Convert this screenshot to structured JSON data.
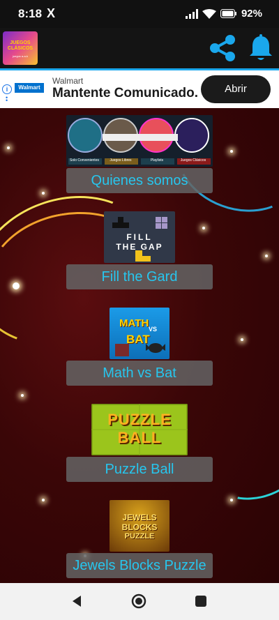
{
  "status": {
    "time": "8:18",
    "x_icon": "X",
    "battery": "92%"
  },
  "appbar": {
    "logo_title": "JUEGOS CLÁSICOS",
    "logo_subtitle": "juegos a-a-k"
  },
  "ad": {
    "brand_logo": "Walmart",
    "brand": "Walmart",
    "headline": "Mantente Comunicado.",
    "cta": "Abrir"
  },
  "menu": [
    {
      "label": "Quienes somos",
      "thumb": "about-collage",
      "captions": [
        "Solo Convenientes",
        "Juegos Libres",
        "Playlists",
        "Juegos Clásicos"
      ]
    },
    {
      "label": "Fill the Gard",
      "thumb": "fill-the-gap",
      "title1": "FILL",
      "title2": "THE GAP"
    },
    {
      "label": "Math vs Bat",
      "thumb": "math-vs-bat",
      "title1": "MATH",
      "title2": "VS",
      "title3": "BAT"
    },
    {
      "label": "Puzzle Ball",
      "thumb": "puzzle-ball",
      "title1": "PUZZLE",
      "title2": "BALL"
    },
    {
      "label": "Jewels Blocks Puzzle",
      "thumb": "jewels-blocks",
      "title1": "JEWELS",
      "title2": "BLOCKS",
      "title3": "PUZZLE"
    }
  ],
  "colors": {
    "accent": "#1aa7ec",
    "label_text": "#27c6ee",
    "background": "#3a0607"
  }
}
